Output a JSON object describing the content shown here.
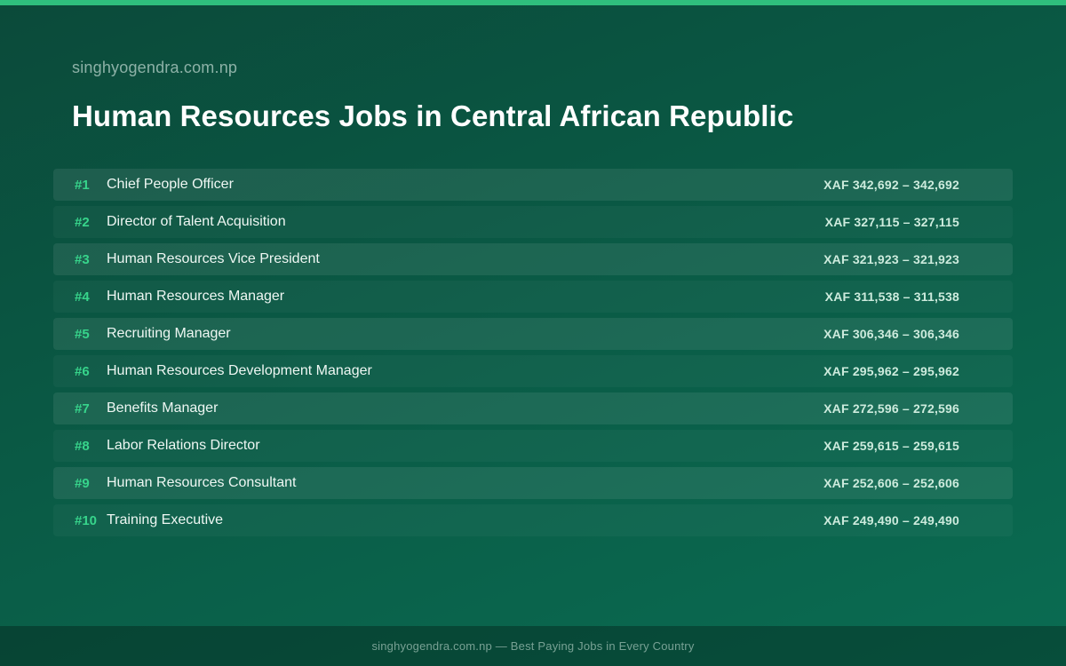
{
  "header": {
    "site_name": "singhyogendra.com.np",
    "title": "Human Resources Jobs in Central African Republic"
  },
  "jobs": [
    {
      "rank": "#1",
      "title": "Chief People Officer",
      "salary": "XAF 342,692 – 342,692"
    },
    {
      "rank": "#2",
      "title": "Director of Talent Acquisition",
      "salary": "XAF 327,115 – 327,115"
    },
    {
      "rank": "#3",
      "title": "Human Resources Vice President",
      "salary": "XAF 321,923 – 321,923"
    },
    {
      "rank": "#4",
      "title": "Human Resources Manager",
      "salary": "XAF 311,538 – 311,538"
    },
    {
      "rank": "#5",
      "title": "Recruiting Manager",
      "salary": "XAF 306,346 – 306,346"
    },
    {
      "rank": "#6",
      "title": "Human Resources Development Manager",
      "salary": "XAF 295,962 – 295,962"
    },
    {
      "rank": "#7",
      "title": "Benefits Manager",
      "salary": "XAF 272,596 – 272,596"
    },
    {
      "rank": "#8",
      "title": "Labor Relations Director",
      "salary": "XAF 259,615 – 259,615"
    },
    {
      "rank": "#9",
      "title": "Human Resources Consultant",
      "salary": "XAF 252,606 – 252,606"
    },
    {
      "rank": "#10",
      "title": "Training Executive",
      "salary": "XAF 249,490 – 249,490"
    }
  ],
  "footer": {
    "text": "singhyogendra.com.np — Best Paying Jobs in Every Country"
  },
  "colors": {
    "accent": "#2fbf7d",
    "rank": "#37d48b",
    "background_start": "#0b4a3a",
    "background_end": "#0a6c52"
  }
}
